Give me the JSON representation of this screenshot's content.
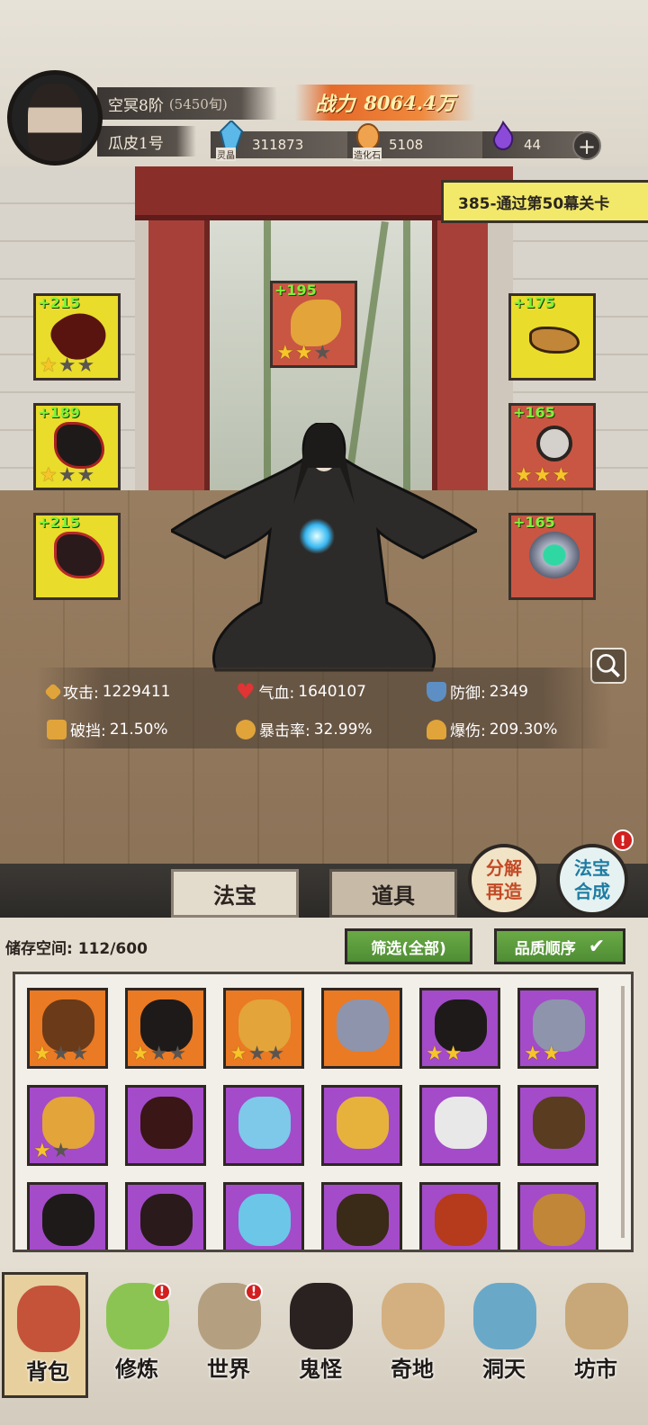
{
  "player": {
    "realm": "空冥8阶",
    "realm_sub": "(5450旬)",
    "name": "瓜皮1号",
    "power_label": "战力",
    "power_value": "8064.4万"
  },
  "resources": [
    {
      "caption": "灵晶",
      "value": "311873",
      "icon": "crystal-icon"
    },
    {
      "caption": "造化石",
      "value": "5108",
      "icon": "stone-icon"
    },
    {
      "caption": "",
      "value": "44",
      "icon": "soul-flame-icon"
    }
  ],
  "quest": "385-通过第50幕关卡",
  "equipped": [
    {
      "slot": "weapon",
      "bonus": "+215",
      "stars": 1,
      "max_stars": 3,
      "color": "#eadc2a"
    },
    {
      "slot": "robe",
      "bonus": "+189",
      "stars": 1,
      "max_stars": 3,
      "color": "#eadc2a"
    },
    {
      "slot": "boots",
      "bonus": "+215",
      "stars": 0,
      "max_stars": 3,
      "color": "#eadc2a"
    },
    {
      "slot": "talisman",
      "bonus": "+195",
      "stars": 2,
      "max_stars": 3,
      "color": "#c85643"
    },
    {
      "slot": "crown",
      "bonus": "+175",
      "stars": 0,
      "max_stars": 3,
      "color": "#eadc2a"
    },
    {
      "slot": "necklace",
      "bonus": "+165",
      "stars": 3,
      "max_stars": 3,
      "color": "#c85643"
    },
    {
      "slot": "ring",
      "bonus": "+165",
      "stars": 0,
      "max_stars": 3,
      "color": "#c85643"
    }
  ],
  "stats": {
    "attack_label": "攻击:",
    "attack": "1229411",
    "hp_label": "气血:",
    "hp": "1640107",
    "defense_label": "防御:",
    "defense": "2349",
    "pierce_label": "破挡:",
    "pierce": "21.50%",
    "crit_label": "暴击率:",
    "crit": "32.99%",
    "critdmg_label": "爆伤:",
    "critdmg": "209.30%"
  },
  "tabs": {
    "treasure": "法宝",
    "items": "道具"
  },
  "actions": {
    "decompose_1": "分解",
    "decompose_2": "再造",
    "synth_1": "法宝",
    "synth_2": "合成",
    "synth_badge": "!"
  },
  "inventory": {
    "storage_label": "储存空间:",
    "storage_value": "112/600",
    "filter": "筛选(全部)",
    "sort": "品质顺序",
    "items": [
      {
        "rarity": "orange",
        "stars": 1,
        "max_stars": 3,
        "icon": "staff-icon"
      },
      {
        "rarity": "orange",
        "stars": 1,
        "max_stars": 3,
        "icon": "robe-icon"
      },
      {
        "rarity": "orange",
        "stars": 1,
        "max_stars": 3,
        "icon": "talisman-icon"
      },
      {
        "rarity": "orange",
        "stars": 0,
        "max_stars": 0,
        "icon": "ring-icon"
      },
      {
        "rarity": "purple",
        "stars": 2,
        "max_stars": 2,
        "icon": "robe-icon"
      },
      {
        "rarity": "purple",
        "stars": 2,
        "max_stars": 2,
        "icon": "ring-icon"
      },
      {
        "rarity": "purple",
        "stars": 1,
        "max_stars": 2,
        "icon": "talisman-icon"
      },
      {
        "rarity": "purple",
        "stars": 0,
        "max_stars": 0,
        "icon": "saw-disc-icon"
      },
      {
        "rarity": "purple",
        "stars": 0,
        "max_stars": 0,
        "icon": "bow-icon"
      },
      {
        "rarity": "purple",
        "stars": 0,
        "max_stars": 0,
        "icon": "mask-icon"
      },
      {
        "rarity": "purple",
        "stars": 0,
        "max_stars": 0,
        "icon": "white-robe-icon"
      },
      {
        "rarity": "purple",
        "stars": 0,
        "max_stars": 0,
        "icon": "brown-robe-icon"
      },
      {
        "rarity": "purple",
        "stars": 0,
        "max_stars": 0,
        "icon": "robe-icon"
      },
      {
        "rarity": "purple",
        "stars": 0,
        "max_stars": 0,
        "icon": "boots-icon"
      },
      {
        "rarity": "purple",
        "stars": 0,
        "max_stars": 0,
        "icon": "crystal-icon"
      },
      {
        "rarity": "purple",
        "stars": 0,
        "max_stars": 0,
        "icon": "dagger-icon"
      },
      {
        "rarity": "purple",
        "stars": 0,
        "max_stars": 0,
        "icon": "lion-icon"
      },
      {
        "rarity": "purple",
        "stars": 0,
        "max_stars": 0,
        "icon": "crown-icon"
      }
    ]
  },
  "nav": [
    {
      "label": "背包",
      "icon": "bag-icon",
      "active": true,
      "dot": ""
    },
    {
      "label": "修炼",
      "icon": "lotus-icon",
      "active": false,
      "dot": "!"
    },
    {
      "label": "世界",
      "icon": "scroll-map-icon",
      "active": false,
      "dot": "!"
    },
    {
      "label": "鬼怪",
      "icon": "demon-egg-icon",
      "active": false,
      "dot": ""
    },
    {
      "label": "奇地",
      "icon": "pagoda-icon",
      "active": false,
      "dot": ""
    },
    {
      "label": "洞天",
      "icon": "portal-icon",
      "active": false,
      "dot": ""
    },
    {
      "label": "坊市",
      "icon": "market-stall-icon",
      "active": false,
      "dot": ""
    }
  ],
  "colors": {
    "orange_rarity": "#ea7a23",
    "purple_rarity": "#a44bc9",
    "yellow_slot": "#eadc2a",
    "red_slot": "#c85643",
    "bonus_green": "#7df23a",
    "star": "#f6c52a"
  }
}
